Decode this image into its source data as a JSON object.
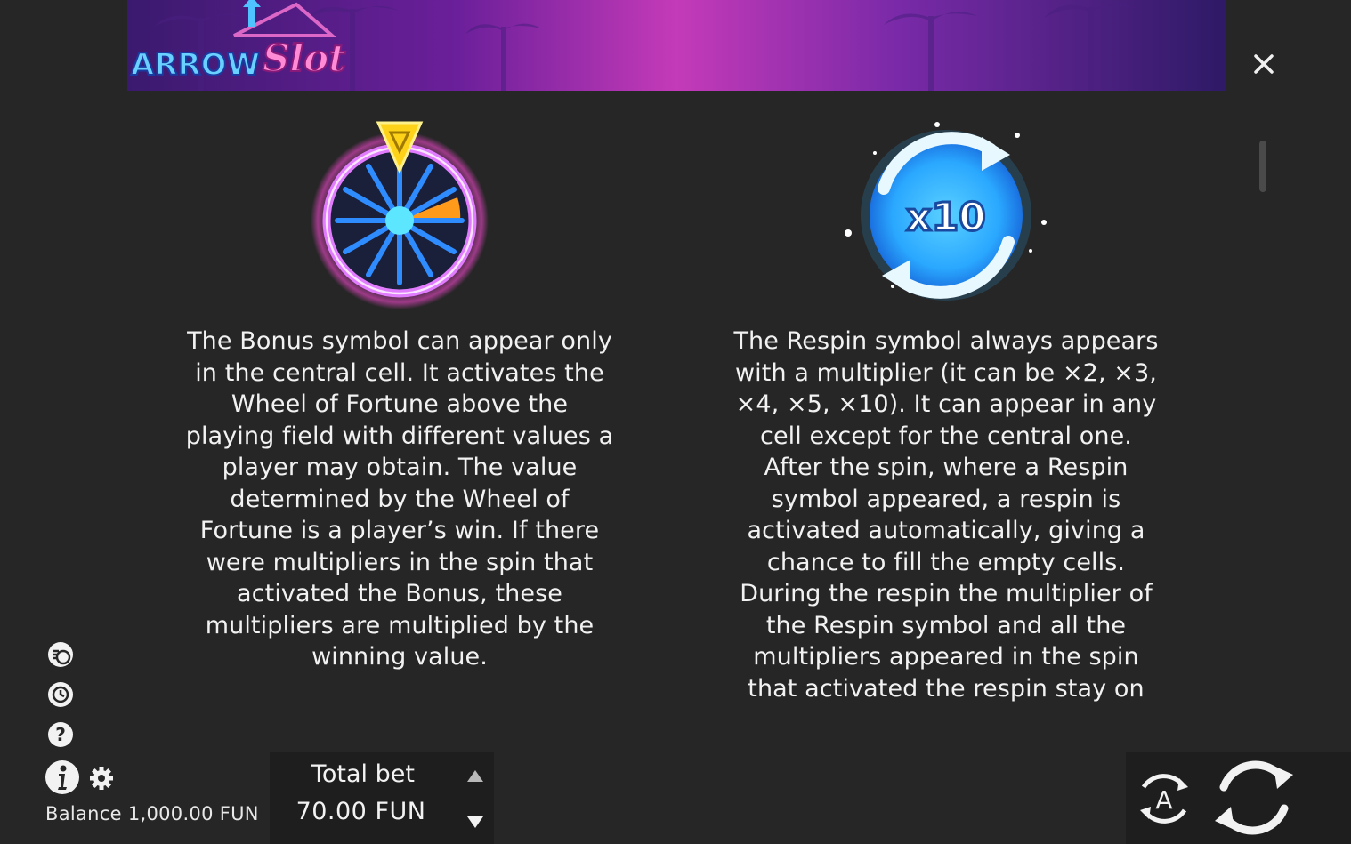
{
  "game": {
    "logo_text_part1": "ARROW",
    "logo_text_part2": "Slot"
  },
  "paytable": {
    "bonus": {
      "icon": "wheel-of-fortune-icon",
      "description": "The Bonus symbol can appear only\nin the central cell. It activates the\nWheel of Fortune above the\nplaying field with different values a\nplayer may  obtain. The value\ndetermined by the Wheel of\nFortune is a player’s win. If there\nwere multipliers in the spin that\nactivated the Bonus, these\nmultipliers are multiplied by the\nwinning value."
    },
    "respin": {
      "icon": "respin-icon",
      "multiplier_label": "x10",
      "description": "The Respin symbol always appears\nwith a multiplier (it can be ×2, ×3,\n×4, ×5, ×10). It can appear in any\ncell except for the central one.\nAfter the spin, where a Respin\nsymbol appeared, a respin is\nactivated automatically, giving a\nchance to fill the empty cells.\nDuring the respin the multiplier of\nthe Respin symbol and all the\nmultipliers appeared in the spin\nthat activated the respin stay on"
    }
  },
  "side_icons": [
    "coins-icon",
    "history-icon",
    "help-icon"
  ],
  "bottom_bar": {
    "balance_label": "Balance",
    "balance_value": "1,000.00 FUN",
    "balance_text": "Balance 1,000.00 FUN",
    "total_bet_label": "Total bet",
    "total_bet_value": "70.00 FUN"
  },
  "colors": {
    "background": "#262626",
    "text": "#f2f2f2",
    "wheel_ring": "#d050e0",
    "wheel_spokes": "#2f8cff",
    "wheel_segment": "#ff9a1a",
    "respin_blue": "#2ab0ff"
  }
}
